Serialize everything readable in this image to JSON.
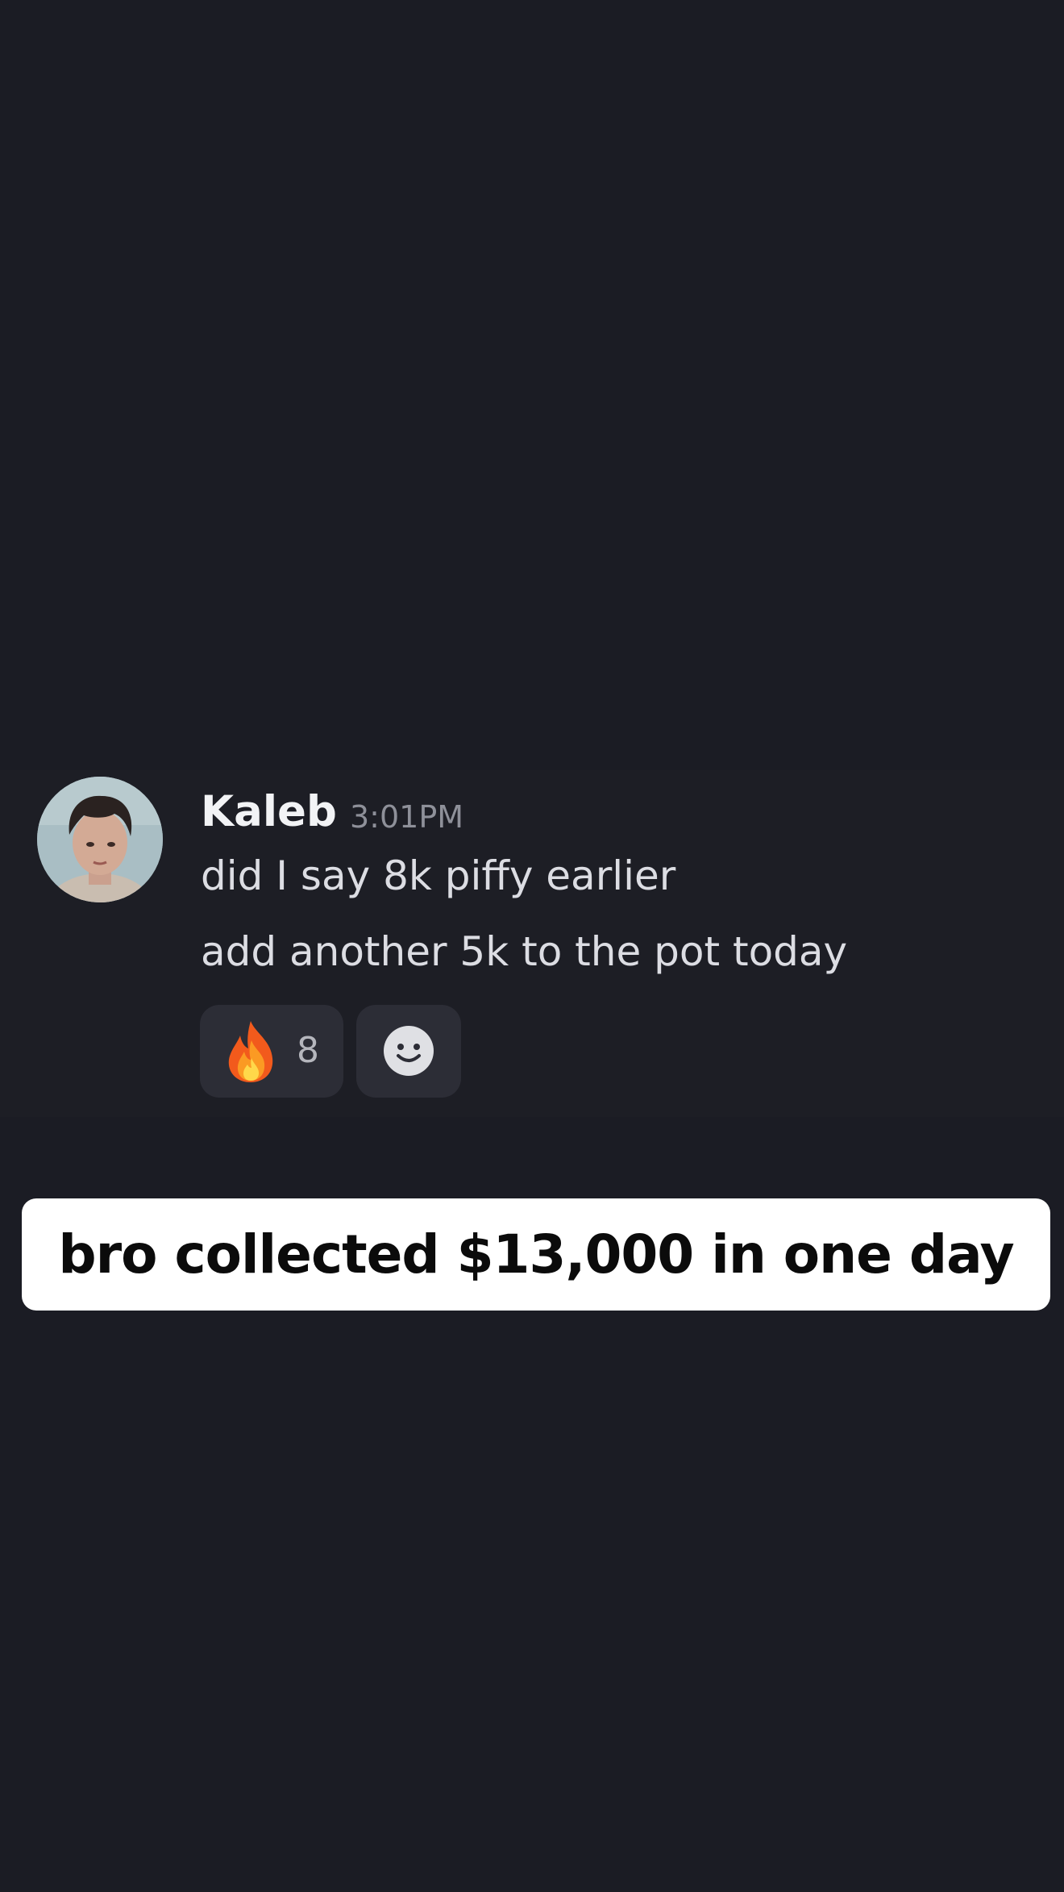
{
  "message": {
    "author": "Kaleb",
    "timestamp": "3:01PM",
    "lines": [
      "did I say 8k piffy earlier",
      "add another 5k to the pot today"
    ],
    "reactions": [
      {
        "emoji": "fire-icon",
        "count": "8"
      },
      {
        "emoji": "add-reaction-smile-icon"
      }
    ]
  },
  "caption": "bro collected $13,000 in one day",
  "colors": {
    "background": "#1b1c24",
    "reaction_bg": "#2c2d36",
    "author": "#f2f3f5",
    "text": "#dcdde3",
    "timestamp": "#8e9099",
    "caption_bg": "#ffffff",
    "caption_text": "#0b0b0b"
  }
}
